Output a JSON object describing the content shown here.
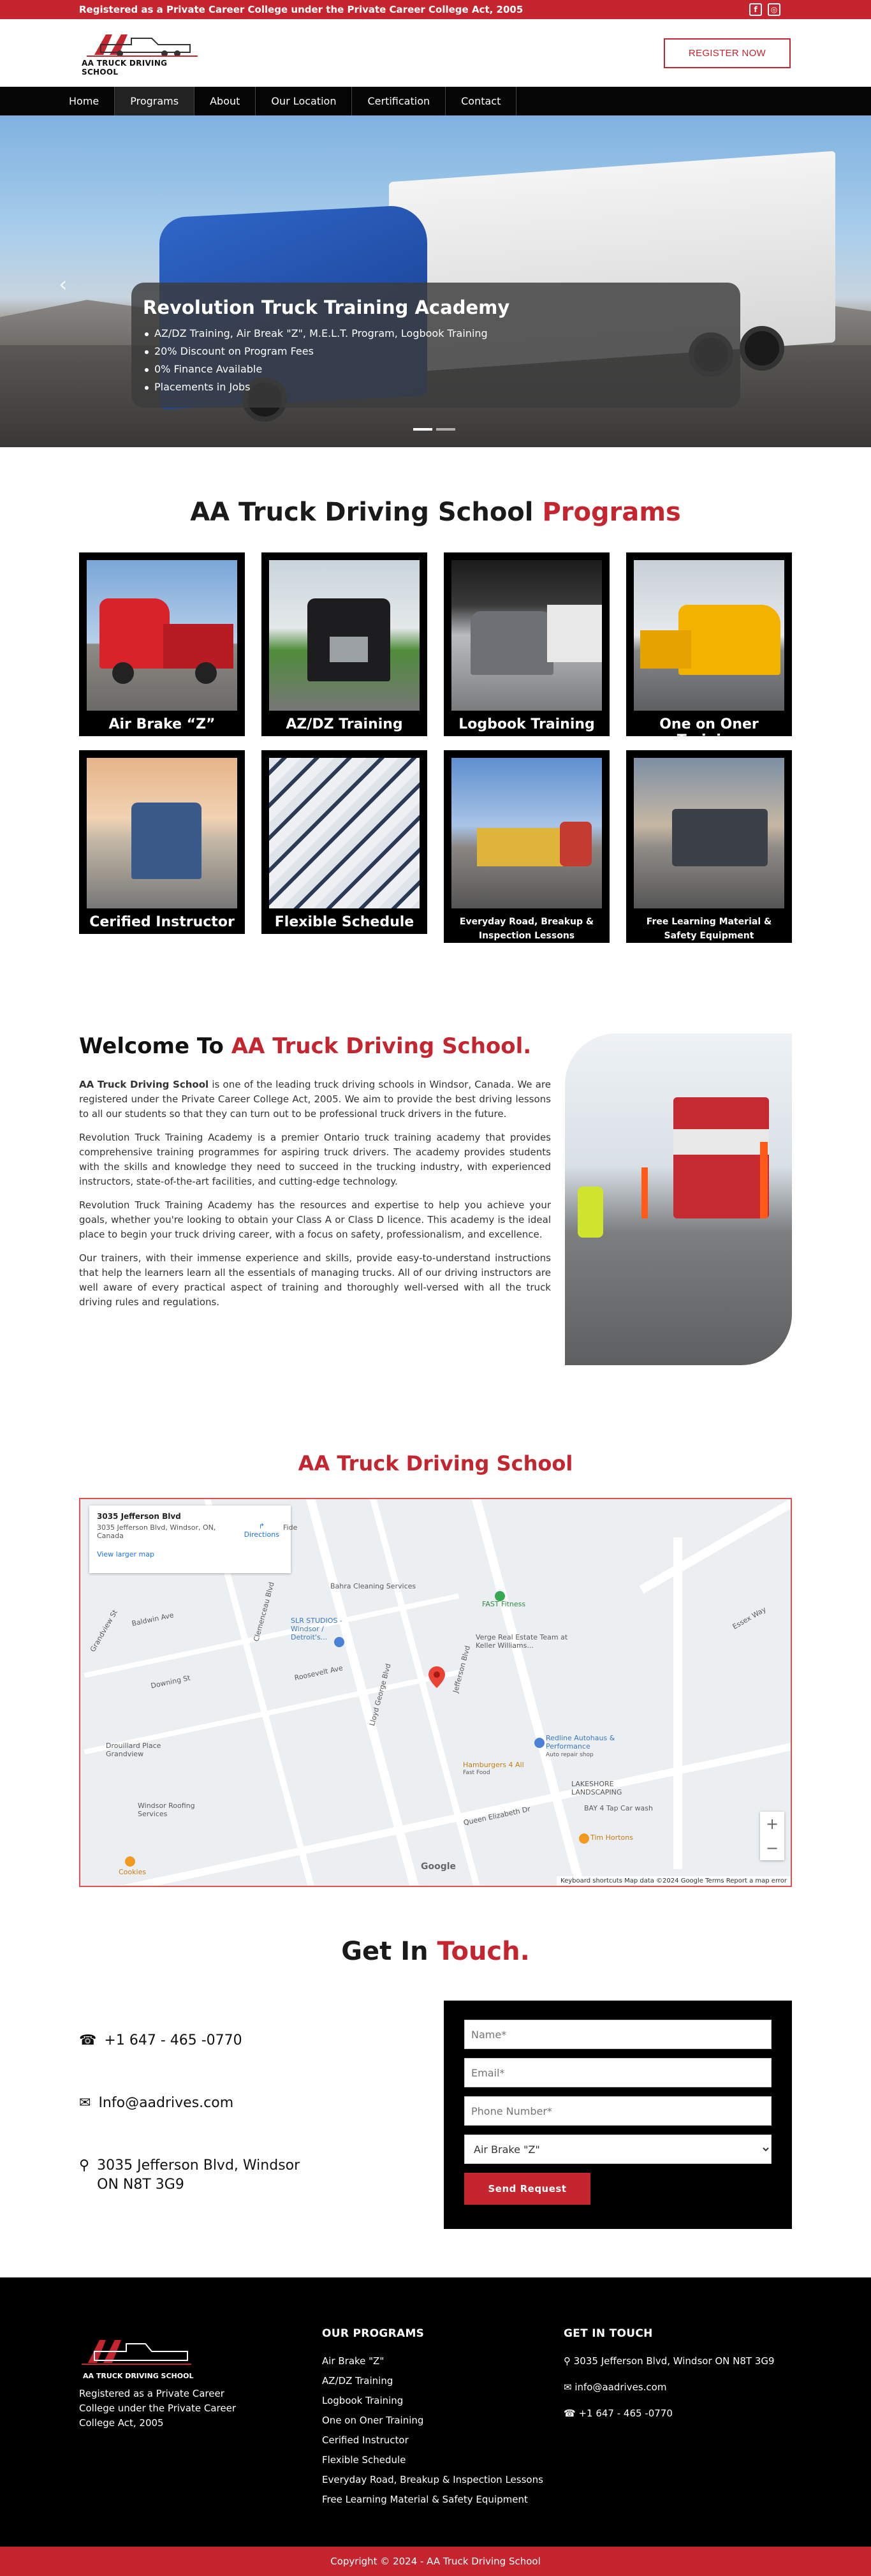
{
  "topbar": {
    "notice": "Registered as a Private Career College under the Private Career College Act, 2005",
    "social": [
      "facebook-icon",
      "instagram-icon"
    ]
  },
  "header": {
    "logo_text": "AA TRUCK DRIVING SCHOOL",
    "register_label": "Register Now"
  },
  "nav": [
    "Home",
    "Programs",
    "About",
    "Our Location",
    "Certification",
    "Contact"
  ],
  "hero": {
    "title": "Revolution Truck Training Academy",
    "bullets": [
      "AZ/DZ Training, Air Break \"Z\", M.E.L.T. Program, Logbook Training",
      "20% Discount on Program Fees",
      "0% Finance Available",
      "Placements in Jobs"
    ]
  },
  "programs": {
    "title_prefix": "AA Truck Driving School",
    "title_accent": "Programs",
    "items": [
      "Air Brake “Z”",
      "AZ/DZ Training",
      "Logbook Training",
      "One on Oner Training",
      "Cerified Instructor",
      "Flexible Schedule",
      "Everyday Road, Breakup & Inspection Lessons",
      "Free Learning Material & Safety Equipment"
    ]
  },
  "welcome": {
    "title_prefix": "Welcome To",
    "title_accent": "AA Truck Driving School.",
    "bold_lead": "AA Truck Driving School",
    "p1": " is one of the leading truck driving schools in Windsor, Canada. We are registered under the Private Career College Act, 2005. We aim to provide the best driving lessons to all our students so that they can turn out to be professional truck drivers in the future.",
    "p2": "Revolution Truck Training Academy is a premier Ontario truck training academy that provides comprehensive training programmes for aspiring truck drivers. The academy provides students with the skills and knowledge they need to succeed in the trucking industry, with experienced instructors, state-of-the-art facilities, and cutting-edge technology.",
    "p3": "Revolution Truck Training Academy has the resources and expertise to help you achieve your goals, whether you're looking to obtain your Class A or Class D licence. This academy is the ideal place to begin your truck driving career, with a focus on safety, professionalism, and excellence.",
    "p4": "Our trainers, with their immense experience and skills, provide easy-to-understand instructions that help the learners learn all the essentials of managing trucks. All of our driving instructors are well aware of every practical aspect of training and thoroughly well-versed with all the truck driving rules and regulations."
  },
  "map": {
    "title": "AA Truck Driving School",
    "info_title": "3035 Jefferson Blvd",
    "info_address": "3035 Jefferson Blvd, Windsor, ON, Canada",
    "directions": "Directions",
    "larger_map": "View larger map",
    "labels": {
      "bahra": "Bahra Cleaning Services",
      "fast": "FAST Fitness",
      "slr": "SLR STUDIOS - Windsor / Detroit's...",
      "verge": "Verge Real Estate Team at Keller Williams...",
      "redline": "Redline Autohaus & Performance",
      "redline_sub": "Auto repair shop",
      "hamburgers": "Hamburgers 4 All",
      "hamburgers_sub": "Fast Food",
      "lakeshore": "LAKESHORE LANDSCAPING",
      "bay4": "BAY 4 Tap Car wash",
      "tim": "Tim Hortons",
      "drouillard": "Drouillard Place Grandview",
      "windsor_roofing": "Windsor Roofing Services",
      "cookies": "Cookies",
      "essex": "Essex Way",
      "jefferson": "Jefferson Blvd",
      "queen": "Queen Elizabeth Dr",
      "lloyd": "Lloyd George Blvd",
      "clemenceau": "Clemenceau Blvd",
      "grandview": "Grandview St",
      "baldwin": "Baldwin Ave",
      "roosevelt": "Roosevelt Ave",
      "downing": "Downing St",
      "fide": "Fide"
    },
    "footer": "Keyboard shortcuts   Map data ©2024 Google   Terms   Report a map error",
    "google": "Google"
  },
  "contact": {
    "title_prefix": "Get In",
    "title_accent": "Touch.",
    "phone": "+1 647 - 465 -0770",
    "email": "Info@aadrives.com",
    "address_line1": "3035 Jefferson Blvd, Windsor",
    "address_line2": "ON N8T 3G9",
    "form": {
      "name_ph": "Name*",
      "email_ph": "Email*",
      "phone_ph": "Phone Number*",
      "select_value": "Air Brake \"Z\"",
      "send_label": "Send Request"
    }
  },
  "footer": {
    "logo_text": "AA TRUCK DRIVING SCHOOL",
    "about": "Registered as a Private Career College under the Private Career College Act, 2005",
    "programs_title": "OUR PROGRAMS",
    "programs": [
      "Air Brake \"Z\"",
      "AZ/DZ Training",
      "Logbook Training",
      "One on Oner Training",
      "Cerified Instructor",
      "Flexible Schedule",
      "Everyday Road, Breakup & Inspection Lessons",
      "Free Learning Material & Safety Equipment"
    ],
    "touch_title": "GET IN TOUCH",
    "address": "3035 Jefferson Blvd, Windsor ON N8T 3G9",
    "email": "info@aadrives.com",
    "phone": "+1 647 - 465 -0770",
    "copyright": "Copyright © 2024 - AA Truck Driving School"
  },
  "colors": {
    "brand_red": "#c4252e",
    "black": "#000000"
  }
}
